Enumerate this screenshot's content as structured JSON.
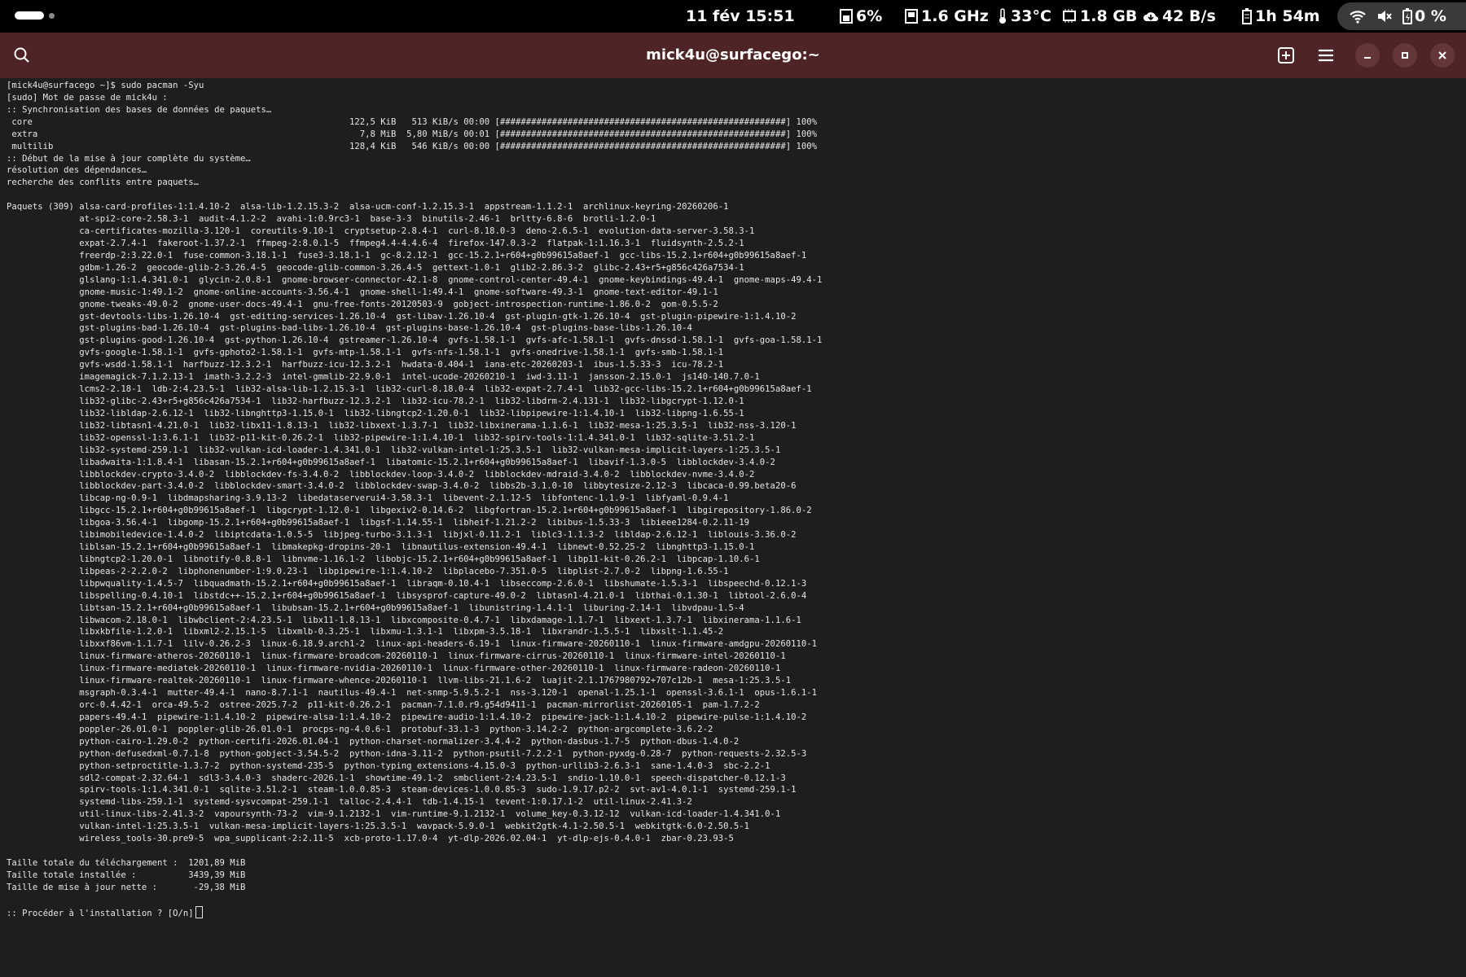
{
  "status_bar": {
    "datetime": "11 fév  15:51",
    "cpu": "6%",
    "freq": "1.6 GHz",
    "temp": "33°C",
    "memory": "1.8 GB",
    "network": "42 B/s",
    "battery_time": "1h 54m",
    "battery_percent": "0 %"
  },
  "window": {
    "title": "mick4u@surfacego:~"
  },
  "terminal": {
    "lines": [
      "[mick4u@surfacego ~]$ sudo pacman -Syu",
      "[sudo] Mot de passe de mick4u :",
      ":: Synchronisation des bases de données de paquets…",
      " core                                                             122,5 KiB   513 KiB/s 00:00 [#######################################################] 100%",
      " extra                                                              7,8 MiB  5,80 MiB/s 00:01 [#######################################################] 100%",
      " multilib                                                         128,4 KiB   546 KiB/s 00:00 [#######################################################] 100%",
      ":: Début de la mise à jour complète du système…",
      "résolution des dépendances…",
      "recherche des conflits entre paquets…",
      "",
      "Paquets (309) alsa-card-profiles-1:1.4.10-2  alsa-lib-1.2.15.3-2  alsa-ucm-conf-1.2.15.3-1  appstream-1.1.2-1  archlinux-keyring-20260206-1",
      "              at-spi2-core-2.58.3-1  audit-4.1.2-2  avahi-1:0.9rc3-1  base-3-3  binutils-2.46-1  brltty-6.8-6  brotli-1.2.0-1",
      "              ca-certificates-mozilla-3.120-1  coreutils-9.10-1  cryptsetup-2.8.4-1  curl-8.18.0-3  deno-2.6.5-1  evolution-data-server-3.58.3-1",
      "              expat-2.7.4-1  fakeroot-1.37.2-1  ffmpeg-2:8.0.1-5  ffmpeg4.4-4.4.6-4  firefox-147.0.3-2  flatpak-1:1.16.3-1  fluidsynth-2.5.2-1",
      "              freerdp-2:3.22.0-1  fuse-common-3.18.1-1  fuse3-3.18.1-1  gc-8.2.12-1  gcc-15.2.1+r604+g0b99615a8aef-1  gcc-libs-15.2.1+r604+g0b99615a8aef-1",
      "              gdbm-1.26-2  geocode-glib-2-3.26.4-5  geocode-glib-common-3.26.4-5  gettext-1.0-1  glib2-2.86.3-2  glibc-2.43+r5+g856c426a7534-1",
      "              glslang-1:1.4.341.0-1  glycin-2.0.8-1  gnome-browser-connector-42.1-8  gnome-control-center-49.4-1  gnome-keybindings-49.4-1  gnome-maps-49.4-1",
      "              gnome-music-1:49.1-2  gnome-online-accounts-3.56.4-1  gnome-shell-1:49.4-1  gnome-software-49.3-1  gnome-text-editor-49.1-1",
      "              gnome-tweaks-49.0-2  gnome-user-docs-49.4-1  gnu-free-fonts-20120503-9  gobject-introspection-runtime-1.86.0-2  gom-0.5.5-2",
      "              gst-devtools-libs-1.26.10-4  gst-editing-services-1.26.10-4  gst-libav-1.26.10-4  gst-plugin-gtk-1.26.10-4  gst-plugin-pipewire-1:1.4.10-2",
      "              gst-plugins-bad-1.26.10-4  gst-plugins-bad-libs-1.26.10-4  gst-plugins-base-1.26.10-4  gst-plugins-base-libs-1.26.10-4",
      "              gst-plugins-good-1.26.10-4  gst-python-1.26.10-4  gstreamer-1.26.10-4  gvfs-1.58.1-1  gvfs-afc-1.58.1-1  gvfs-dnssd-1.58.1-1  gvfs-goa-1.58.1-1",
      "              gvfs-google-1.58.1-1  gvfs-gphoto2-1.58.1-1  gvfs-mtp-1.58.1-1  gvfs-nfs-1.58.1-1  gvfs-onedrive-1.58.1-1  gvfs-smb-1.58.1-1",
      "              gvfs-wsdd-1.58.1-1  harfbuzz-12.3.2-1  harfbuzz-icu-12.3.2-1  hwdata-0.404-1  iana-etc-20260203-1  ibus-1.5.33-3  icu-78.2-1",
      "              imagemagick-7.1.2.13-1  imath-3.2.2-3  intel-gmmlib-22.9.0-1  intel-ucode-20260210-1  iwd-3.11-1  jansson-2.15.0-1  js140-140.7.0-1",
      "              lcms2-2.18-1  ldb-2:4.23.5-1  lib32-alsa-lib-1.2.15.3-1  lib32-curl-8.18.0-4  lib32-expat-2.7.4-1  lib32-gcc-libs-15.2.1+r604+g0b99615a8aef-1",
      "              lib32-glibc-2.43+r5+g856c426a7534-1  lib32-harfbuzz-12.3.2-1  lib32-icu-78.2-1  lib32-libdrm-2.4.131-1  lib32-libgcrypt-1.12.0-1",
      "              lib32-libldap-2.6.12-1  lib32-libnghttp3-1.15.0-1  lib32-libngtcp2-1.20.0-1  lib32-libpipewire-1:1.4.10-1  lib32-libpng-1.6.55-1",
      "              lib32-libtasn1-4.21.0-1  lib32-libx11-1.8.13-1  lib32-libxext-1.3.7-1  lib32-libxinerama-1.1.6-1  lib32-mesa-1:25.3.5-1  lib32-nss-3.120-1",
      "              lib32-openssl-1:3.6.1-1  lib32-p11-kit-0.26.2-1  lib32-pipewire-1:1.4.10-1  lib32-spirv-tools-1:1.4.341.0-1  lib32-sqlite-3.51.2-1",
      "              lib32-systemd-259.1-1  lib32-vulkan-icd-loader-1.4.341.0-1  lib32-vulkan-intel-1:25.3.5-1  lib32-vulkan-mesa-implicit-layers-1:25.3.5-1",
      "              libadwaita-1:1.8.4-1  libasan-15.2.1+r604+g0b99615a8aef-1  libatomic-15.2.1+r604+g0b99615a8aef-1  libavif-1.3.0-5  libblockdev-3.4.0-2",
      "              libblockdev-crypto-3.4.0-2  libblockdev-fs-3.4.0-2  libblockdev-loop-3.4.0-2  libblockdev-mdraid-3.4.0-2  libblockdev-nvme-3.4.0-2",
      "              libblockdev-part-3.4.0-2  libblockdev-smart-3.4.0-2  libblockdev-swap-3.4.0-2  libbs2b-3.1.0-10  libbytesize-2.12-3  libcaca-0.99.beta20-6",
      "              libcap-ng-0.9-1  libdmapsharing-3.9.13-2  libedataserverui4-3.58.3-1  libevent-2.1.12-5  libfontenc-1.1.9-1  libfyaml-0.9.4-1",
      "              libgcc-15.2.1+r604+g0b99615a8aef-1  libgcrypt-1.12.0-1  libgexiv2-0.14.6-2  libgfortran-15.2.1+r604+g0b99615a8aef-1  libgirepository-1.86.0-2",
      "              libgoa-3.56.4-1  libgomp-15.2.1+r604+g0b99615a8aef-1  libgsf-1.14.55-1  libheif-1.21.2-2  libibus-1.5.33-3  libieee1284-0.2.11-19",
      "              libimobiledevice-1.4.0-2  libiptcdata-1.0.5-5  libjpeg-turbo-3.1.3-1  libjxl-0.11.2-1  liblc3-1.1.3-2  libldap-2.6.12-1  liblouis-3.36.0-2",
      "              liblsan-15.2.1+r604+g0b99615a8aef-1  libmakepkg-dropins-20-1  libnautilus-extension-49.4-1  libnewt-0.52.25-2  libnghttp3-1.15.0-1",
      "              libngtcp2-1.20.0-1  libnotify-0.8.8-1  libnvme-1.16.1-2  libobjc-15.2.1+r604+g0b99615a8aef-1  libp11-kit-0.26.2-1  libpcap-1.10.6-1",
      "              libpeas-2-2.2.0-2  libphonenumber-1:9.0.23-1  libpipewire-1:1.4.10-2  libplacebo-7.351.0-5  libplist-2.7.0-2  libpng-1.6.55-1",
      "              libpwquality-1.4.5-7  libquadmath-15.2.1+r604+g0b99615a8aef-1  libraqm-0.10.4-1  libseccomp-2.6.0-1  libshumate-1.5.3-1  libspeechd-0.12.1-3",
      "              libspelling-0.4.10-1  libstdc++-15.2.1+r604+g0b99615a8aef-1  libsysprof-capture-49.0-2  libtasn1-4.21.0-1  libthai-0.1.30-1  libtool-2.6.0-4",
      "              libtsan-15.2.1+r604+g0b99615a8aef-1  libubsan-15.2.1+r604+g0b99615a8aef-1  libunistring-1.4.1-1  liburing-2.14-1  libvdpau-1.5-4",
      "              libwacom-2.18.0-1  libwbclient-2:4.23.5-1  libx11-1.8.13-1  libxcomposite-0.4.7-1  libxdamage-1.1.7-1  libxext-1.3.7-1  libxinerama-1.1.6-1",
      "              libxkbfile-1.2.0-1  libxml2-2.15.1-5  libxmlb-0.3.25-1  libxmu-1.3.1-1  libxpm-3.5.18-1  libxrandr-1.5.5-1  libxslt-1.1.45-2",
      "              libxxf86vm-1.1.7-1  lilv-0.26.2-3  linux-6.18.9.arch1-2  linux-api-headers-6.19-1  linux-firmware-20260110-1  linux-firmware-amdgpu-20260110-1",
      "              linux-firmware-atheros-20260110-1  linux-firmware-broadcom-20260110-1  linux-firmware-cirrus-20260110-1  linux-firmware-intel-20260110-1",
      "              linux-firmware-mediatek-20260110-1  linux-firmware-nvidia-20260110-1  linux-firmware-other-20260110-1  linux-firmware-radeon-20260110-1",
      "              linux-firmware-realtek-20260110-1  linux-firmware-whence-20260110-1  llvm-libs-21.1.6-2  luajit-2.1.1767980792+707c12b-1  mesa-1:25.3.5-1",
      "              msgraph-0.3.4-1  mutter-49.4-1  nano-8.7.1-1  nautilus-49.4-1  net-snmp-5.9.5.2-1  nss-3.120-1  openal-1.25.1-1  openssl-3.6.1-1  opus-1.6.1-1",
      "              orc-0.4.42-1  orca-49.5-2  ostree-2025.7-2  p11-kit-0.26.2-1  pacman-7.1.0.r9.g54d9411-1  pacman-mirrorlist-20260105-1  pam-1.7.2-2",
      "              papers-49.4-1  pipewire-1:1.4.10-2  pipewire-alsa-1:1.4.10-2  pipewire-audio-1:1.4.10-2  pipewire-jack-1:1.4.10-2  pipewire-pulse-1:1.4.10-2",
      "              poppler-26.01.0-1  poppler-glib-26.01.0-1  procps-ng-4.0.6-1  protobuf-33.1-3  python-3.14.2-2  python-argcomplete-3.6.2-2",
      "              python-cairo-1.29.0-2  python-certifi-2026.01.04-1  python-charset-normalizer-3.4.4-2  python-dasbus-1.7-5  python-dbus-1.4.0-2",
      "              python-defusedxml-0.7.1-8  python-gobject-3.54.5-2  python-idna-3.11-2  python-psutil-7.2.2-1  python-pyxdg-0.28-7  python-requests-2.32.5-3",
      "              python-setproctitle-1.3.7-2  python-systemd-235-5  python-typing_extensions-4.15.0-3  python-urllib3-2.6.3-1  sane-1.4.0-3  sbc-2.2-1",
      "              sdl2-compat-2.32.64-1  sdl3-3.4.0-3  shaderc-2026.1-1  showtime-49.1-2  smbclient-2:4.23.5-1  sndio-1.10.0-1  speech-dispatcher-0.12.1-3",
      "              spirv-tools-1:1.4.341.0-1  sqlite-3.51.2-1  steam-1.0.0.85-3  steam-devices-1.0.0.85-3  sudo-1.9.17.p2-2  svt-av1-4.0.1-1  systemd-259.1-1",
      "              systemd-libs-259.1-1  systemd-sysvcompat-259.1-1  talloc-2.4.4-1  tdb-1.4.15-1  tevent-1:0.17.1-2  util-linux-2.41.3-2",
      "              util-linux-libs-2.41.3-2  vapoursynth-73-2  vim-9.1.2132-1  vim-runtime-9.1.2132-1  volume_key-0.3.12-12  vulkan-icd-loader-1.4.341.0-1",
      "              vulkan-intel-1:25.3.5-1  vulkan-mesa-implicit-layers-1:25.3.5-1  wavpack-5.9.0-1  webkit2gtk-4.1-2.50.5-1  webkitgtk-6.0-2.50.5-1",
      "              wireless_tools-30.pre9-5  wpa_supplicant-2:2.11-5  xcb-proto-1.17.0-4  yt-dlp-2026.02.04-1  yt-dlp-ejs-0.4.0-1  zbar-0.23.93-5",
      "",
      "Taille totale du téléchargement :  1201,89 MiB",
      "Taille totale installée :          3439,39 MiB",
      "Taille de mise à jour nette :       -29,38 MiB",
      ""
    ],
    "prompt": ":: Procéder à l'installation ? [O/n]"
  }
}
